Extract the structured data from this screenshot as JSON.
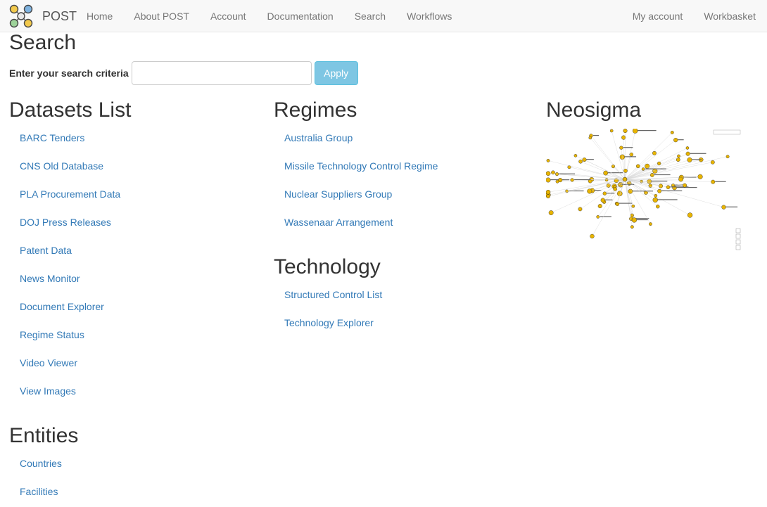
{
  "navbar": {
    "brand": "POST",
    "left_links": [
      "Home",
      "About POST",
      "Account",
      "Documentation",
      "Search",
      "Workflows"
    ],
    "right_links": [
      "My account",
      "Workbasket"
    ]
  },
  "search": {
    "title": "Search",
    "label": "Enter your search criteria",
    "input_value": "",
    "apply_label": "Apply"
  },
  "datasets": {
    "title": "Datasets List",
    "items": [
      "BARC Tenders",
      "CNS Old Database",
      "PLA Procurement Data",
      "DOJ Press Releases",
      "Patent Data",
      "News Monitor",
      "Document Explorer",
      "Regime Status",
      "Video Viewer",
      "View Images"
    ]
  },
  "entities": {
    "title": "Entities",
    "items": [
      "Countries",
      "Facilities"
    ]
  },
  "regimes": {
    "title": "Regimes",
    "items": [
      "Australia Group",
      "Missile Technology Control Regime",
      "Nuclear Suppliers Group",
      "Wassenaar Arrangement"
    ]
  },
  "technology": {
    "title": "Technology",
    "items": [
      "Structured Control List",
      "Technology Explorer"
    ]
  },
  "neosigma": {
    "title": "Neosigma"
  },
  "colors": {
    "link": "#337ab7",
    "navbar_bg": "#f8f8f8",
    "apply_bg": "#7ec6e3",
    "graph_node": "#e8b400"
  }
}
